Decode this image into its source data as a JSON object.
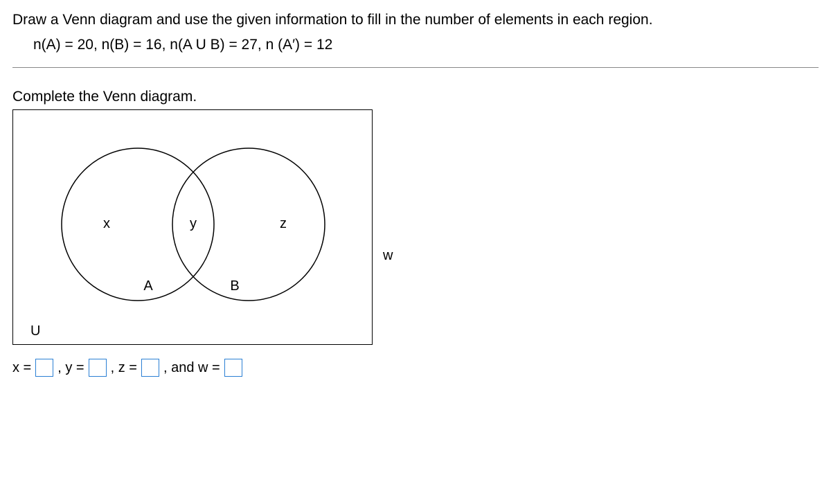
{
  "question": {
    "prompt": "Draw a Venn diagram and use the given information to fill in the number of elements in each region.",
    "given": "n(A) = 20, n(B) = 16, n(A U B) = 27, n (A′) = 12"
  },
  "instruction": "Complete the Venn diagram.",
  "venn": {
    "regionA_only": "x",
    "intersection": "y",
    "regionB_only": "z",
    "outside": "w",
    "labelA": "A",
    "labelB": "B",
    "universe": "U"
  },
  "answers": {
    "prefix_x": "x =",
    "prefix_y": ", y =",
    "prefix_z": ", z =",
    "prefix_w": ", and w =",
    "value_x": "",
    "value_y": "",
    "value_z": "",
    "value_w": ""
  },
  "chart_data": {
    "type": "venn",
    "sets": [
      "A",
      "B"
    ],
    "given_values": {
      "n_A": 20,
      "n_B": 16,
      "n_A_union_B": 27,
      "n_A_complement": 12
    },
    "region_labels": {
      "A_only": "x",
      "intersection": "y",
      "B_only": "z",
      "outside": "w"
    },
    "universe_label": "U"
  }
}
